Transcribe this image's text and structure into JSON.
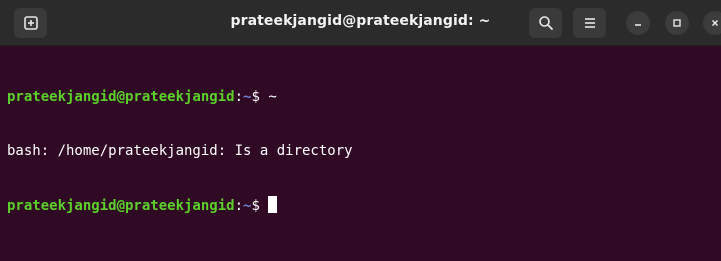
{
  "window": {
    "title": "prateekjangid@prateekjangid: ~"
  },
  "header": {
    "new_tab_icon": "new-tab-icon",
    "search_icon": "search-icon",
    "menu_icon": "hamburger-menu-icon",
    "minimize_icon": "minimize-icon",
    "maximize_icon": "maximize-icon",
    "close_icon": "close-icon"
  },
  "terminal": {
    "lines": [
      {
        "user": "prateekjangid@prateekjangid",
        "sep": ":",
        "path": "~",
        "symbol": "$ ",
        "command": "~"
      },
      {
        "output": "bash: /home/prateekjangid: Is a directory"
      },
      {
        "user": "prateekjangid@prateekjangid",
        "sep": ":",
        "path": "~",
        "symbol": "$ ",
        "command": ""
      }
    ]
  },
  "colors": {
    "background": "#300a24",
    "titlebar": "#2b2b2b",
    "prompt_user": "#5bd12a",
    "prompt_path": "#6f7fd0",
    "text": "#ffffff"
  }
}
